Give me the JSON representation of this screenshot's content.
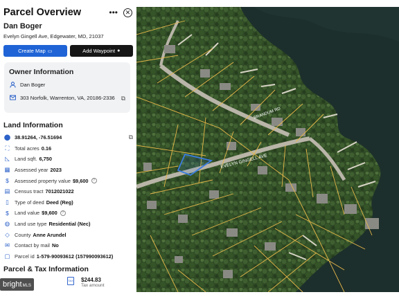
{
  "panel": {
    "title": "Parcel Overview",
    "more_icon": "more-horizontal-icon",
    "close_icon": "close-circle-icon",
    "owner_name": "Dan Boger",
    "address": "Evelyn Gingell Ave, Edgewater, MD, 21037",
    "buttons": {
      "create_map": "Create Map",
      "add_waypoint": "Add Waypoint"
    }
  },
  "owner_info": {
    "title": "Owner Information",
    "name": "Dan Boger",
    "mailing_address": "303 Norfolk, Warrenton, VA, 20186-2336"
  },
  "land_info": {
    "title": "Land Information",
    "rows": [
      {
        "icon": "location-pin-icon",
        "label": "",
        "value": "38.91264, -76.51694"
      },
      {
        "icon": "area-icon",
        "label": "Total acres",
        "value": "0.16"
      },
      {
        "icon": "ruler-icon",
        "label": "Land sqft.",
        "value": "6,750"
      },
      {
        "icon": "calendar-icon",
        "label": "Assessed year",
        "value": "2023"
      },
      {
        "icon": "dollar-icon",
        "label": "Assessed property value",
        "value": "$9,600"
      },
      {
        "icon": "census-icon",
        "label": "Census tract",
        "value": "7012021022"
      },
      {
        "icon": "deed-icon",
        "label": "Type of deed",
        "value": "Deed (Reg)"
      },
      {
        "icon": "dollar-icon",
        "label": "Land value",
        "value": "$9,600"
      },
      {
        "icon": "land-use-icon",
        "label": "Land use type",
        "value": "Residential (Nec)"
      },
      {
        "icon": "county-icon",
        "label": "County",
        "value": "Anne Arundel"
      },
      {
        "icon": "mail-icon",
        "label": "Contact by mail",
        "value": "No"
      },
      {
        "icon": "parcel-icon",
        "label": "Parcel id",
        "value": "1-579-90093612 (157990093612)"
      }
    ]
  },
  "tax_info": {
    "title": "Parcel & Tax Information",
    "amount": "$244.83",
    "amount_label": "Tax amount"
  },
  "map": {
    "street_labels": [
      "EVELYN GINGELL AVE",
      "BRANDUM RD"
    ],
    "water_color": "#1d2f2c",
    "parcel_line_color": "#e8b84a",
    "selected_parcel_color": "#3b7de0"
  },
  "watermark": {
    "brand": "bright",
    "suffix": "MLS"
  }
}
